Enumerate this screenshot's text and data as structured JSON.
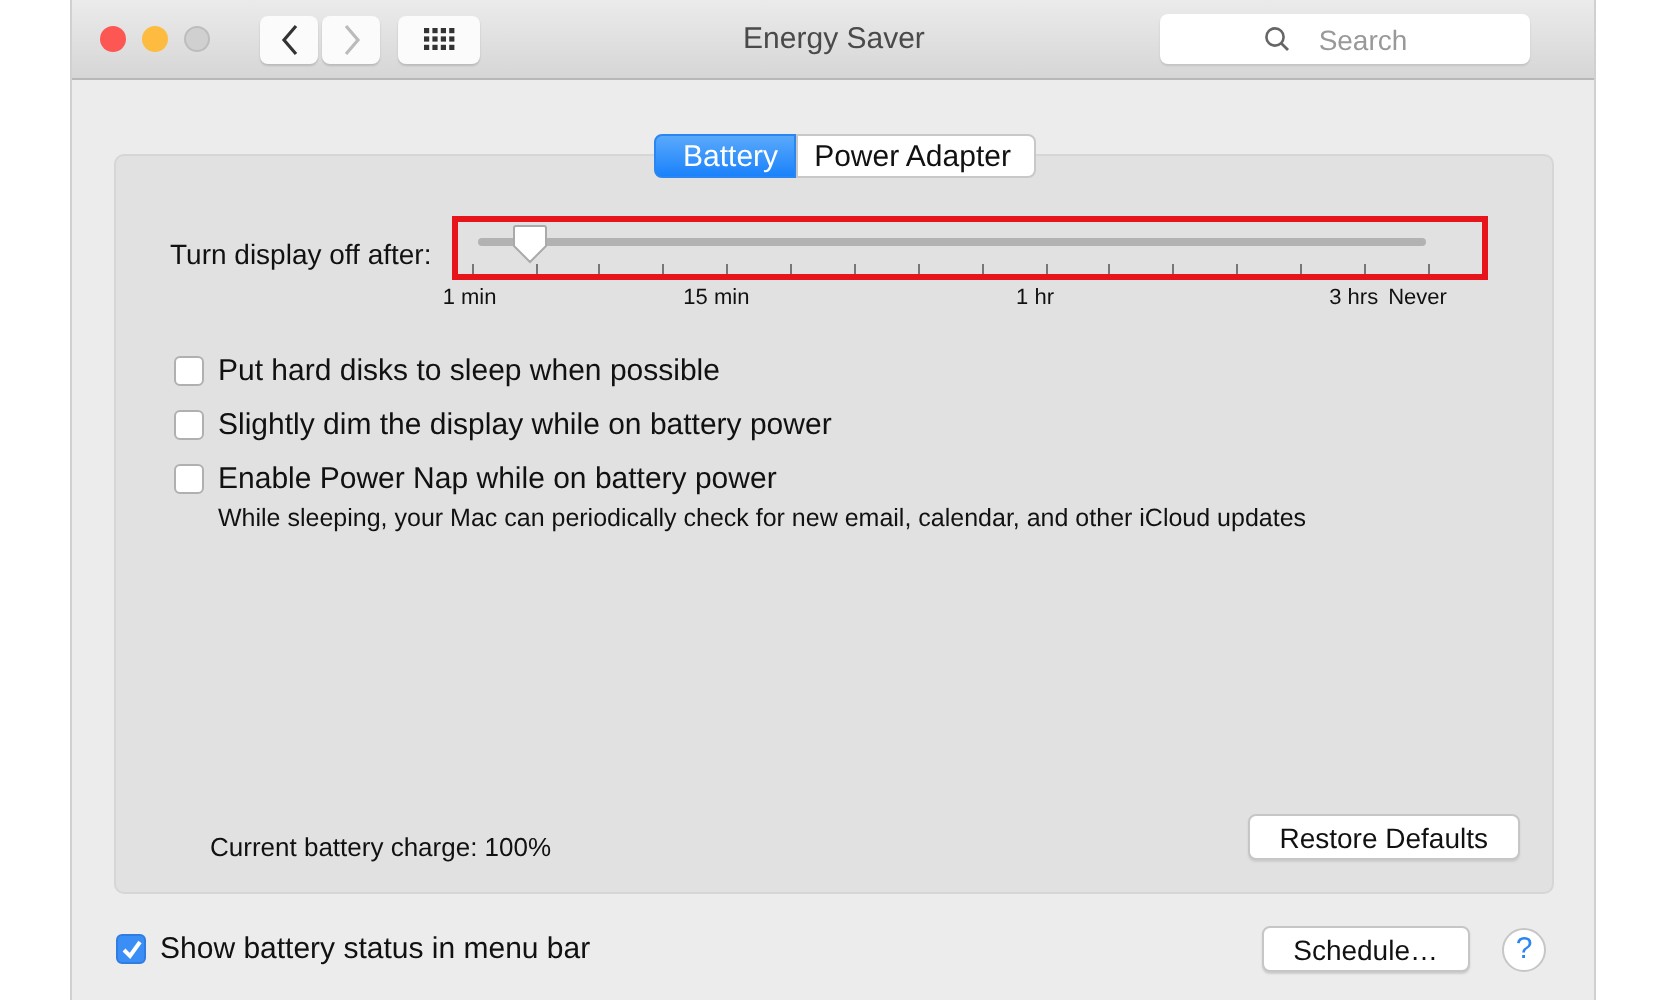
{
  "window": {
    "title": "Energy Saver"
  },
  "toolbar": {
    "search": {
      "placeholder": "Search"
    },
    "back_enabled": true,
    "forward_enabled": false
  },
  "tabs": [
    {
      "label": "Battery",
      "selected": true
    },
    {
      "label": "Power Adapter",
      "selected": false
    }
  ],
  "display_sleep": {
    "label": "Turn display off after:",
    "level": 0.045,
    "highlighted": true,
    "scale_labels": [
      "1 min",
      "15 min",
      "1 hr",
      "3 hrs",
      "Never"
    ]
  },
  "options": [
    {
      "label": "Put hard disks to sleep when possible",
      "checked": false
    },
    {
      "label": "Slightly dim the display while on battery power",
      "checked": false
    },
    {
      "label": "Enable Power Nap while on battery power",
      "checked": false,
      "note": "While sleeping, your Mac can periodically check for new email, calendar, and other iCloud updates"
    }
  ],
  "battery_charge": "Current battery charge: 100%",
  "restore_button": "Restore Defaults",
  "show_status": {
    "label": "Show battery status in menu bar",
    "checked": true
  },
  "schedule_button": "Schedule…",
  "help_button": "?"
}
